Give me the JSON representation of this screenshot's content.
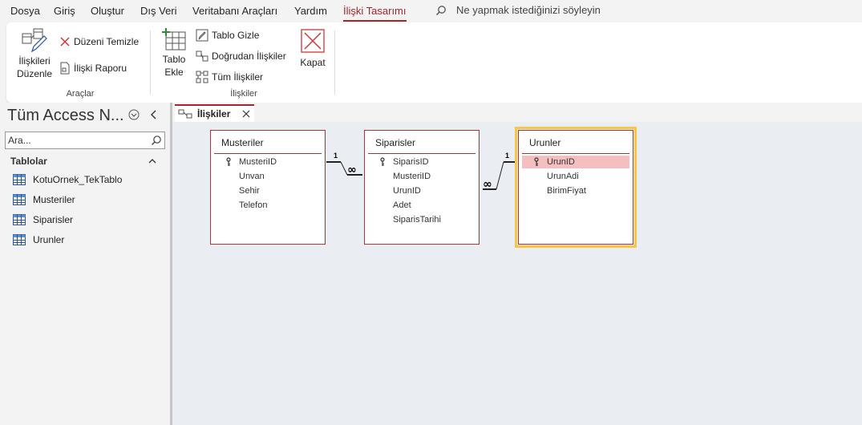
{
  "menu": {
    "items": [
      "Dosya",
      "Giriş",
      "Oluştur",
      "Dış Veri",
      "Veritabanı Araçları",
      "Yardım",
      "İlişki Tasarımı"
    ],
    "active_index": 6,
    "tell_me": "Ne yapmak istediğinizi söyleyin"
  },
  "ribbon": {
    "araclar": {
      "label": "Araçlar",
      "edit_line1": "İlişkileri",
      "edit_line2": "Düzenle",
      "clear_layout": "Düzeni Temizle",
      "report": "İlişki Raporu"
    },
    "iliskiler": {
      "label": "İlişkiler",
      "add_line1": "Tablo",
      "add_line2": "Ekle",
      "hide_table": "Tablo Gizle",
      "direct": "Doğrudan İlişkiler",
      "all": "Tüm İlişkiler",
      "close": "Kapat"
    }
  },
  "nav": {
    "title": "Tüm Access N...",
    "search_placeholder": "Ara...",
    "group": "Tablolar",
    "items": [
      "KotuOrnek_TekTablo",
      "Musteriler",
      "Siparisler",
      "Urunler"
    ]
  },
  "doc_tab": {
    "label": "İlişkiler"
  },
  "tables": [
    {
      "name": "Musteriler",
      "fields": [
        "MusteriID",
        "Unvan",
        "Sehir",
        "Telefon"
      ],
      "key_field": 0
    },
    {
      "name": "Siparisler",
      "fields": [
        "SiparisID",
        "MusteriID",
        "UrunID",
        "Adet",
        "SiparisTarihi"
      ],
      "key_field": 0
    },
    {
      "name": "Urunler",
      "fields": [
        "UrunID",
        "UrunAdi",
        "BirimFiyat"
      ],
      "key_field": 0,
      "selected": true,
      "highlighted_field": 0
    }
  ],
  "relationships": [
    {
      "from": "Musteriler",
      "to": "Siparisler",
      "one_label": "1",
      "many_label": "∞"
    },
    {
      "from": "Urunler",
      "to": "Siparisler",
      "one_label": "1",
      "many_label": "∞"
    }
  ],
  "colors": {
    "accent": "#a4262c",
    "selection": "#f8c545",
    "highlight": "#f4bfbf"
  }
}
